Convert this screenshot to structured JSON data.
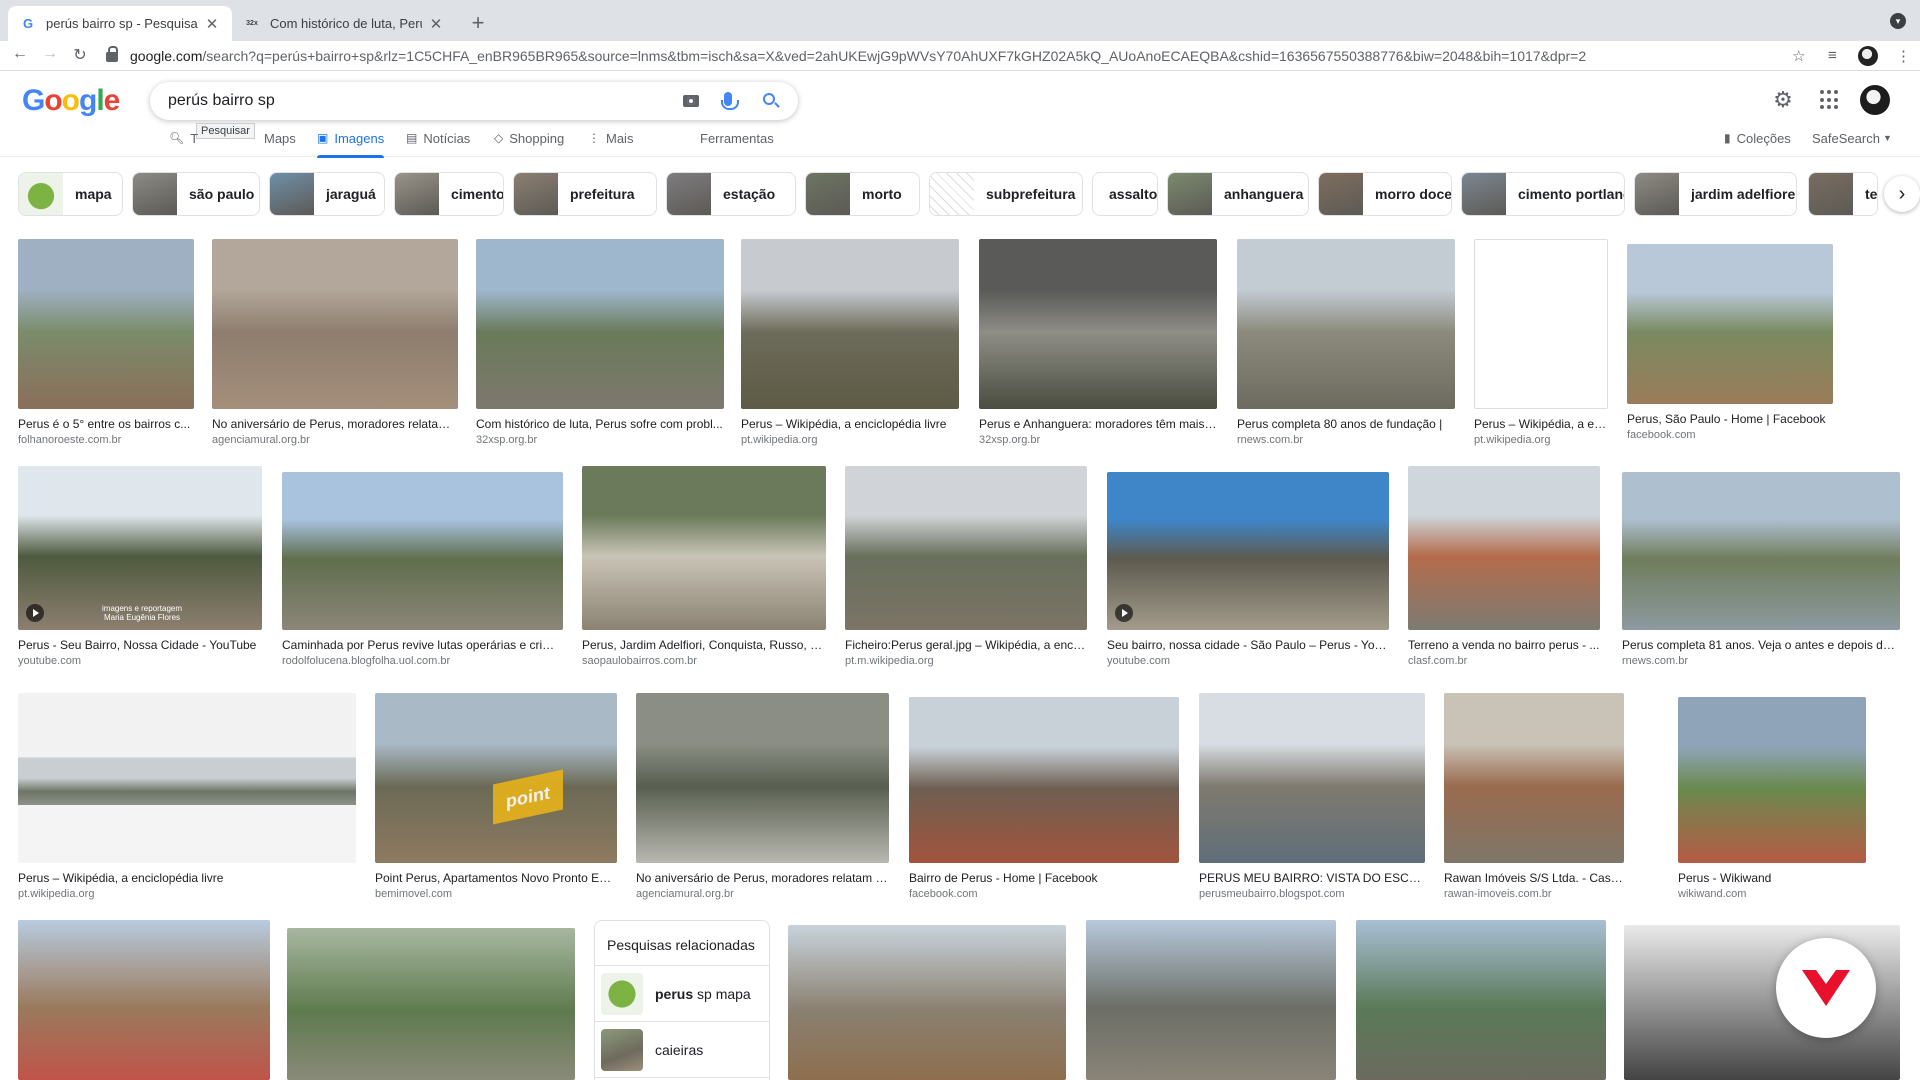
{
  "browser": {
    "tabs": [
      {
        "title": "perús bairro sp - Pesquisa Goo",
        "active": true,
        "favicon": "G"
      },
      {
        "title": "Com histórico de luta, Perus so",
        "active": false,
        "favicon": "32x"
      }
    ],
    "url_host": "google.com",
    "url_rest": "/search?q=perús+bairro+sp&rlz=1C5CHFA_enBR965BR965&source=lnms&tbm=isch&sa=X&ved=2ahUKEwjG9pWVsY70AhUXF7kGHZ02A5kQ_AUoAnoECAEQBA&cshid=1636567550388776&biw=2048&bih=1017&dpr=2"
  },
  "google": {
    "logo_letters": [
      "G",
      "o",
      "o",
      "g",
      "l",
      "e"
    ],
    "query": "perús bairro sp",
    "tooltip": "Pesquisar",
    "tabs": [
      {
        "label": "Todas",
        "icon": "search-icon",
        "visible_label": "T"
      },
      {
        "label": "Maps",
        "icon": ""
      },
      {
        "label": "Imagens",
        "icon": "image-icon",
        "active": true
      },
      {
        "label": "Notícias",
        "icon": "news-icon"
      },
      {
        "label": "Shopping",
        "icon": "tag-icon"
      },
      {
        "label": "Mais",
        "icon": "more-vert-icon"
      },
      {
        "label": "Ferramentas",
        "icon": ""
      }
    ],
    "right_tabs": {
      "colecoes": "Coleções",
      "safesearch": "SafeSearch"
    }
  },
  "chips": [
    {
      "label": "mapa",
      "color": "#7cb342"
    },
    {
      "label": "são paulo",
      "color": "#8d8b85"
    },
    {
      "label": "jaraguá",
      "color": "#6f8fa8"
    },
    {
      "label": "cimento",
      "color": "#9a948a"
    },
    {
      "label": "prefeitura",
      "color": "#8c7f72"
    },
    {
      "label": "estação",
      "color": "#7f7c80"
    },
    {
      "label": "morto",
      "color": "#6d7562"
    },
    {
      "label": "subprefeitura",
      "color": "#e9e9e9"
    },
    {
      "label": "assalto",
      "color": ""
    },
    {
      "label": "anhanguera",
      "color": "#7b8a6e"
    },
    {
      "label": "morro doce",
      "color": "#7e6e5e"
    },
    {
      "label": "cimento portland",
      "color": "#7c8793"
    },
    {
      "label": "jardim adelfiore",
      "color": "#8e8b84"
    },
    {
      "label": "terr",
      "color": "#7a6d60"
    }
  ],
  "results": [
    {
      "caption": "Perus é o 5° entre os bairros c...",
      "source": "folhanoroeste.com.br",
      "video": false
    },
    {
      "caption": "No aniversário de Perus, moradores relatam ...",
      "source": "agenciamural.org.br",
      "video": false
    },
    {
      "caption": "Com histórico de luta, Perus sofre com probl...",
      "source": "32xsp.org.br",
      "video": false
    },
    {
      "caption": "Perus – Wikipédia, a enciclopédia livre",
      "source": "pt.wikipedia.org",
      "video": false
    },
    {
      "caption": "Perus e Anhanguera: moradores têm mais ...",
      "source": "32xsp.org.br",
      "video": false
    },
    {
      "caption": "Perus completa 80 anos de fundação |",
      "source": "rnews.com.br",
      "video": false
    },
    {
      "caption": "Perus – Wikipédia, a en...",
      "source": "pt.wikipedia.org",
      "video": false
    },
    {
      "caption": "Perus, São Paulo - Home | Facebook",
      "source": "facebook.com",
      "video": false
    },
    {
      "caption": "Perus - Seu Bairro, Nossa Cidade - YouTube",
      "source": "youtube.com",
      "video": true
    },
    {
      "caption": "Caminhada por Perus revive lutas operárias e crime...",
      "source": "rodolfolucena.blogfolha.uol.com.br",
      "video": false
    },
    {
      "caption": "Perus, Jardim Adelfiori, Conquista, Russo, M...",
      "source": "saopaulobairros.com.br",
      "video": false
    },
    {
      "caption": "Ficheiro:Perus geral.jpg – Wikipédia, a encic...",
      "source": "pt.m.wikipedia.org",
      "video": false
    },
    {
      "caption": "Seu bairro, nossa cidade - São Paulo – Perus - YouT...",
      "source": "youtube.com",
      "video": true
    },
    {
      "caption": "Terreno a venda no bairro perus - ...",
      "source": "clasf.com.br",
      "video": false
    },
    {
      "caption": "Perus completa 81 anos. Veja o antes e depois de a...",
      "source": "rnews.com.br",
      "video": false
    },
    {
      "caption": "Perus – Wikipédia, a enciclopédia livre",
      "source": "pt.wikipedia.org",
      "video": false
    },
    {
      "caption": "Point Perus, Apartamentos Novo Pronto Em...",
      "source": "bemimovel.com",
      "video": false
    },
    {
      "caption": "No aniversário de Perus, moradores relatam a...",
      "source": "agenciamural.org.br",
      "video": false
    },
    {
      "caption": "Bairro de Perus - Home | Facebook",
      "source": "facebook.com",
      "video": false
    },
    {
      "caption": "PERUS MEU BAIRRO: VISTA DO ESCADÃ...",
      "source": "perusmeubairro.blogspot.com",
      "video": false
    },
    {
      "caption": "Rawan Imóveis S/S Ltda. - Casa em Sã...",
      "source": "rawan-imoveis.com.br",
      "video": false
    },
    {
      "caption": "Perus - Wikiwand",
      "source": "wikiwand.com",
      "video": false
    }
  ],
  "image_overlays": {
    "watermark_youtube": "imagens e reportagem\nMaria Eugênia Flores",
    "point_logo": "point"
  },
  "related": {
    "title": "Pesquisas relacionadas",
    "items": [
      {
        "bold": "perus",
        "rest": " sp mapa"
      },
      {
        "bold": "",
        "rest": "caieiras"
      }
    ]
  }
}
